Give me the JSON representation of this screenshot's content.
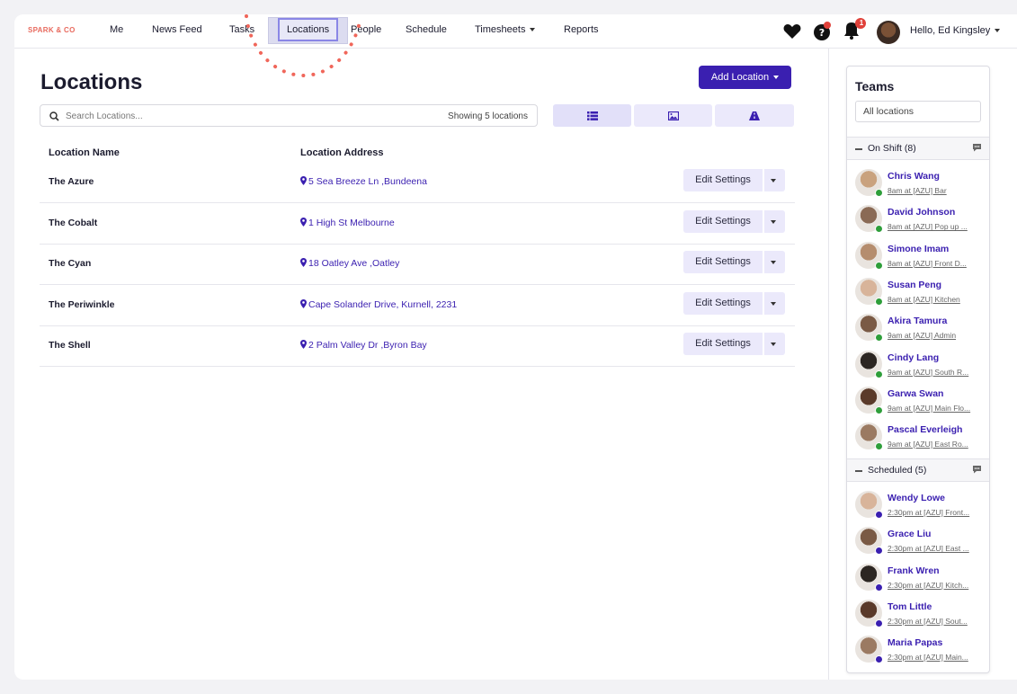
{
  "nav": {
    "brand": "SPARK & CO",
    "items": [
      {
        "label": "Me"
      },
      {
        "label": "News Feed"
      },
      {
        "label": "Tasks"
      },
      {
        "label": "Locations"
      },
      {
        "label": "People"
      },
      {
        "label": "Schedule"
      },
      {
        "label": "Timesheets"
      },
      {
        "label": "Reports"
      }
    ],
    "notification_count": "1",
    "greeting": "Hello, Ed Kingsley"
  },
  "page": {
    "title": "Locations",
    "add_button": "Add Location",
    "search_placeholder": "Search Locations...",
    "showing": "Showing 5 locations",
    "col_name": "Location Name",
    "col_address": "Location Address",
    "edit_label": "Edit Settings"
  },
  "locations": [
    {
      "name": "The Azure",
      "address": "5 Sea Breeze Ln ,Bundeena"
    },
    {
      "name": "The Cobalt",
      "address": "1 High St Melbourne"
    },
    {
      "name": "The Cyan",
      "address": "18 Oatley Ave ,Oatley"
    },
    {
      "name": "The Periwinkle",
      "address": "Cape Solander Drive, Kurnell, 2231"
    },
    {
      "name": "The Shell",
      "address": "2 Palm Valley Dr ,Byron Bay"
    }
  ],
  "teams": {
    "title": "Teams",
    "filter": "All locations",
    "on_shift_label": "On Shift (8)",
    "scheduled_label": "Scheduled (5)",
    "on_shift": [
      {
        "name": "Chris Wang",
        "shift": "8am at [AZU] Bar"
      },
      {
        "name": "David Johnson",
        "shift": "8am at [AZU] Pop up ..."
      },
      {
        "name": "Simone Imam",
        "shift": "8am at [AZU] Front D..."
      },
      {
        "name": "Susan Peng",
        "shift": "8am at [AZU] Kitchen"
      },
      {
        "name": "Akira Tamura",
        "shift": "9am at [AZU] Admin"
      },
      {
        "name": "Cindy Lang",
        "shift": "9am at [AZU] South R..."
      },
      {
        "name": "Garwa Swan",
        "shift": "9am at [AZU] Main Flo..."
      },
      {
        "name": "Pascal Everleigh",
        "shift": "9am at [AZU] East Ro..."
      }
    ],
    "scheduled": [
      {
        "name": "Wendy Lowe",
        "shift": "2:30pm at [AZU] Front..."
      },
      {
        "name": "Grace Liu",
        "shift": "2:30pm at [AZU] East ..."
      },
      {
        "name": "Frank Wren",
        "shift": "2:30pm at [AZU] Kitch..."
      },
      {
        "name": "Tom Little",
        "shift": "2:30pm at [AZU] Sout..."
      },
      {
        "name": "Maria Papas",
        "shift": "2:30pm at [AZU] Main..."
      }
    ]
  },
  "colors": {
    "accent": "#3a1fb0",
    "on_shift_dot": "#2e9e3a",
    "scheduled_dot": "#3a1fb0",
    "annotation": "#f0665a"
  }
}
